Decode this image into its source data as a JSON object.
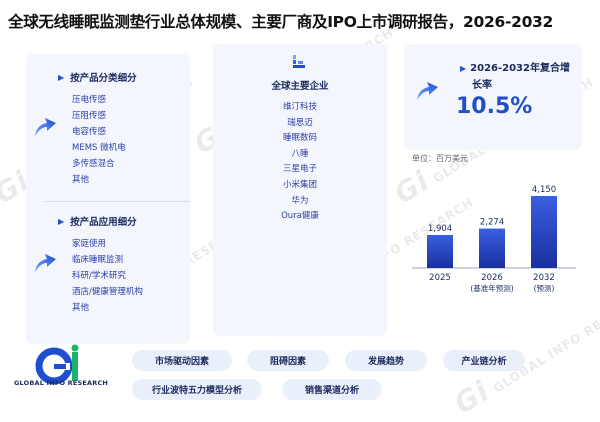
{
  "report": {
    "title": "全球无线睡眠监测垫行业总体规模、主要厂商及IPO上市调研报告，2026-2032"
  },
  "watermark": {
    "logo_letters": "Gi",
    "text": "GLOBAL INFO RESEARCH"
  },
  "product_types": {
    "title": "按产品分类细分",
    "items": [
      "压电传感",
      "压阻传感",
      "电容传感",
      "MEMS 微机电",
      "多传感混合",
      "其他"
    ]
  },
  "applications": {
    "title": "按产品应用细分",
    "items": [
      "家庭使用",
      "临床睡眠监测",
      "科研/学术研究",
      "酒店/健康管理机构",
      "其他"
    ]
  },
  "companies": {
    "title": "全球主要企业",
    "items": [
      "维汀科技",
      "瑞思迈",
      "睡眠数码",
      "八睡",
      "三星电子",
      "小米集团",
      "华为",
      "Oura健康"
    ]
  },
  "cagr": {
    "label_line1": "2026-2032年复合增",
    "label_line2": "长率",
    "value": "10.5%"
  },
  "chart_data": {
    "type": "bar",
    "unit_label": "单位：百万美元",
    "categories": [
      "2025",
      "2026",
      "2032"
    ],
    "category_notes": [
      "",
      "(基准年预测)",
      "(预测)"
    ],
    "values": [
      1904,
      2274,
      4150
    ],
    "value_labels": [
      "1,904",
      "2,274",
      "4,150"
    ],
    "ylim": [
      0,
      4150
    ],
    "grid": false,
    "colors": {
      "bar_top": "#3a5fe0",
      "bar_bottom": "#1a2fa0"
    }
  },
  "logo": {
    "text": "GLOBAL INFO RESEARCH"
  },
  "nav_buttons": [
    "市场驱动因素",
    "阻碍因素",
    "发展趋势",
    "产业链分析",
    "行业波特五力模型分析",
    "销售渠道分析"
  ],
  "colors": {
    "accent": "#2050c8",
    "panel_bg": "#f3f6fc",
    "title": "#111111"
  }
}
